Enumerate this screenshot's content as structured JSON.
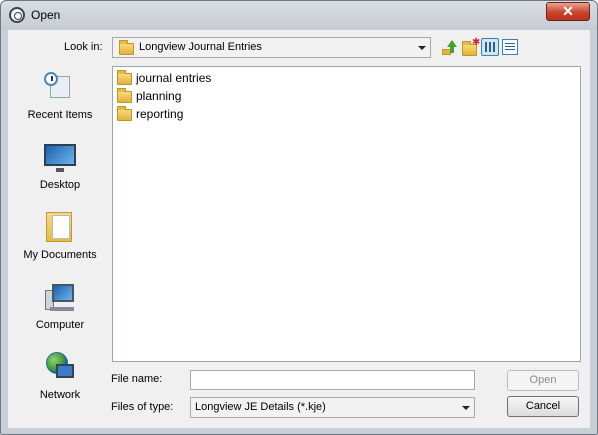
{
  "window": {
    "title": "Open",
    "close_glyph": "✕"
  },
  "toolbar": {
    "lookin_label": "Look in:",
    "lookin_value": "Longview Journal Entries",
    "icons": [
      "up-one-level-icon",
      "new-folder-icon",
      "list-view-icon",
      "details-view-icon"
    ]
  },
  "places": [
    {
      "label": "Recent Items",
      "icon": "recent-items-icon"
    },
    {
      "label": "Desktop",
      "icon": "desktop-icon"
    },
    {
      "label": "My Documents",
      "icon": "my-documents-icon"
    },
    {
      "label": "Computer",
      "icon": "computer-icon"
    },
    {
      "label": "Network",
      "icon": "network-icon"
    }
  ],
  "files": [
    {
      "name": "journal entries",
      "icon": "folder-icon"
    },
    {
      "name": "planning",
      "icon": "folder-icon"
    },
    {
      "name": "reporting",
      "icon": "folder-icon"
    }
  ],
  "form": {
    "file_name_label": "File name:",
    "file_name_value": "",
    "file_type_label": "Files of type:",
    "file_type_value": "Longview JE Details (*.kje)"
  },
  "buttons": {
    "open": "Open",
    "cancel": "Cancel"
  },
  "colors": {
    "close": "#c8452f",
    "folder": "#e0b33a",
    "client": "#f0f0f0"
  }
}
